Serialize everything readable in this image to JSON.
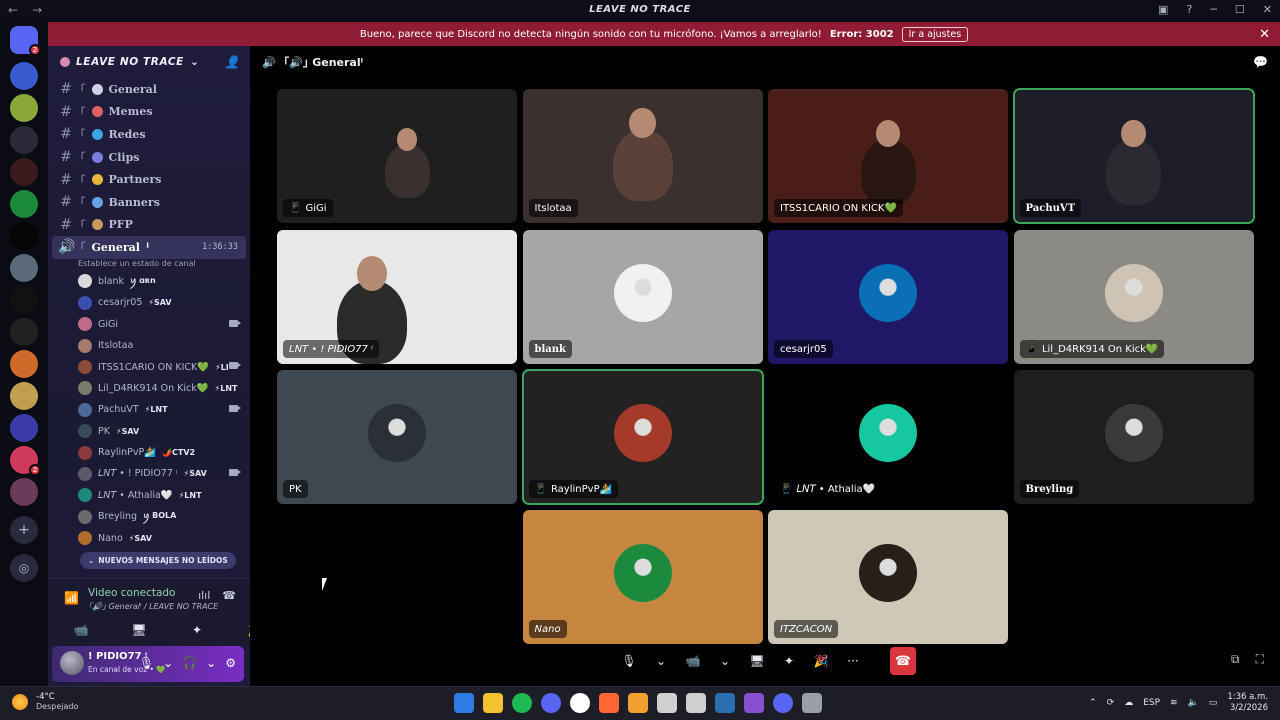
{
  "window": {
    "title": "LEAVE NO TRACE",
    "back": "←",
    "forward": "→"
  },
  "notice": {
    "message": "Bueno, parece que Discord no detecta ningún sonido con tu micrófono. ¡Vamos a arreglarlo!",
    "code": "Error: 3002",
    "action": "Ir a ajustes",
    "close": "✕"
  },
  "server": {
    "name": "LEAVE NO TRACE",
    "chevron": "⌄",
    "invite": "👤"
  },
  "channels": [
    {
      "bracket": "｢",
      "emoji_color": "#cfd0e6",
      "name": "General"
    },
    {
      "bracket": "｢",
      "emoji_color": "#e05f5f",
      "name": "Memes"
    },
    {
      "bracket": "｢",
      "emoji_color": "#3aa3e0",
      "name": "Redes"
    },
    {
      "bracket": "｢",
      "emoji_color": "#7b7ed8",
      "name": "Clips"
    },
    {
      "bracket": "｢",
      "emoji_color": "#e8b63c",
      "name": "Partners"
    },
    {
      "bracket": "｢",
      "emoji_color": "#6aa0e8",
      "name": "Banners"
    },
    {
      "bracket": "｢",
      "emoji_color": "#c79a5b",
      "name": "PFP"
    }
  ],
  "voice_channel": {
    "bracket": "｢",
    "name": "General",
    "suffix": "ˡ",
    "time": "1:36:33",
    "status": "Establece un estado de canal"
  },
  "members": [
    {
      "name": "blank",
      "tag": "ꪗ ɑʀn",
      "camera": false,
      "color": "#d9d9d9"
    },
    {
      "name": "cesarjr05",
      "tag": "⚡SAV",
      "camera": false,
      "color": "#3b4fb0"
    },
    {
      "name": "GiGi",
      "tag": "",
      "camera": true,
      "color": "#c06a8a"
    },
    {
      "name": "Itslotaa",
      "tag": "",
      "camera": false,
      "color": "#a57a6a"
    },
    {
      "name": "ITSS1CARIO ON KICK💚",
      "tag": "⚡LI",
      "camera": true,
      "color": "#8a4b3a"
    },
    {
      "name": "Lil_D4RK914 On Kick💚",
      "tag": "⚡LNT",
      "camera": false,
      "color": "#7a7a6a"
    },
    {
      "name": "PachuVT",
      "tag": "⚡LNT",
      "camera": true,
      "color": "#4a6a9a"
    },
    {
      "name": "PK",
      "tag": "⚡SAV",
      "camera": false,
      "color": "#3a4a5a"
    },
    {
      "name": "RaylinPvP🏄",
      "tag": "🌶️CTV2",
      "camera": false,
      "color": "#8a3a3a"
    },
    {
      "name": "𝘓𝘕𝘛 • ! PIDIO77 ᵎ",
      "tag": "⚡SAV",
      "camera": true,
      "color": "#5a5a6a"
    },
    {
      "name": "𝘓𝘕𝘛 • Athalia🤍",
      "tag": "⚡LNT",
      "camera": false,
      "color": "#1d8a7a"
    },
    {
      "name": "Breyling",
      "tag": "ꪗ BOLA",
      "camera": false,
      "color": "#6a6a6a"
    },
    {
      "name": "Nano",
      "tag": "⚡SAV",
      "camera": false,
      "color": "#b06a2a"
    }
  ],
  "unread": "NUEVOS MENSAJES NO LEÍDOS",
  "voice_status": {
    "title": "Video conectado",
    "subtitle": "｢🔊｣ Generalˡ / LEAVE NO TRACE",
    "buttons": [
      "📹",
      "🖥",
      "✦",
      "🎉"
    ]
  },
  "user": {
    "name": "! PIDIO77 ᵎ",
    "status": "En canal de voz • 💚"
  },
  "main_header": {
    "name": "｢🔊｣ Generalˡ"
  },
  "tiles": [
    {
      "name": "GiGi",
      "device": "📱",
      "style": "normal",
      "selected": false,
      "bg": "#1f1f1f"
    },
    {
      "name": "Itslotaa",
      "device": "",
      "style": "normal",
      "selected": false,
      "bg": "#3a302e"
    },
    {
      "name": "ITSS1CARIO ON KICK💚",
      "device": "",
      "style": "normal",
      "selected": false,
      "bg": "#4a1e18"
    },
    {
      "name": "PachuVT",
      "device": "",
      "style": "serif",
      "selected": true,
      "bg": "#1e1d2a"
    },
    {
      "name": "𝘓𝘕𝘛 • ! PIDIO77 ᵎ",
      "device": "",
      "style": "italic",
      "selected": false,
      "bg": "#e8e8e8"
    },
    {
      "name": "blank",
      "device": "",
      "style": "serif",
      "selected": false,
      "bg": "#a6a6a6"
    },
    {
      "name": "cesarjr05",
      "device": "",
      "style": "normal",
      "selected": false,
      "bg": "#1f1866"
    },
    {
      "name": "Lil_D4RK914 On Kick💚",
      "device": "📱",
      "style": "normal",
      "selected": false,
      "bg": "#8c8a84"
    },
    {
      "name": "PK",
      "device": "",
      "style": "normal",
      "selected": false,
      "bg": "#3e4850"
    },
    {
      "name": "RaylinPvP🏄",
      "device": "📱",
      "style": "normal",
      "selected": true,
      "bg": "#222222"
    },
    {
      "name": "𝘓𝘕𝘛 • Athalia🤍",
      "device": "📱",
      "style": "normal",
      "selected": false,
      "bg": "#000000"
    },
    {
      "name": "Breyling",
      "device": "",
      "style": "serif",
      "selected": false,
      "bg": "#1e1e1e"
    },
    {
      "name": "Nano",
      "device": "",
      "style": "italic",
      "selected": false,
      "bg": "#c7863f"
    },
    {
      "name": "ITZCACON",
      "device": "",
      "style": "italic",
      "selected": false,
      "bg": "#cfc8b6"
    }
  ],
  "call_controls": [
    "🎙",
    "⌄",
    "📹",
    "⌄",
    "🖥",
    "✦",
    "🎉",
    "···",
    "☎"
  ],
  "taskbar": {
    "temp": "-4°C",
    "weather": "Despejado",
    "lang": "ESP",
    "time": "1:36 a.m.",
    "date": "3/2/2026",
    "apps": [
      "#2f7ae5",
      "#f2c230",
      "#1db954",
      "#5865f2",
      "#ffffff",
      "#ff6633",
      "#f0a030",
      "#cfcfcf",
      "#cfcfcf",
      "#2a6fb0",
      "#8a4fd0",
      "#5865f2",
      "#9aa0aa"
    ]
  }
}
